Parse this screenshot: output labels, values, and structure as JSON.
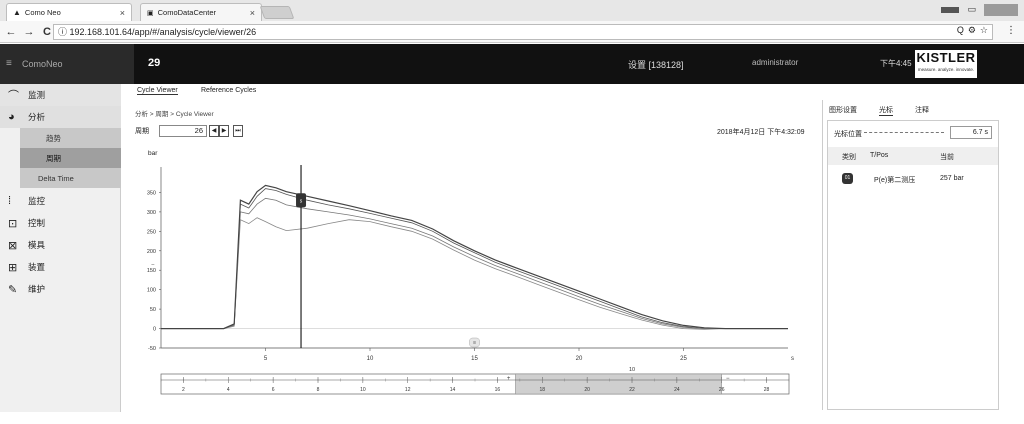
{
  "browser": {
    "tabs": [
      {
        "label": "Como Neo",
        "close": "×"
      },
      {
        "label": "ComoDataCenter",
        "close": "×"
      }
    ],
    "nav": {
      "back": "←",
      "forward": "→",
      "reload": "C"
    },
    "url": "ⓘ 192.168.101.64/app/#/analysis/cycle/viewer/26",
    "url_icons": [
      "Q",
      "⚙",
      "☆"
    ],
    "menu": "⋮"
  },
  "header": {
    "brand": "ComoNeo",
    "cycle_number": "29",
    "setting": "设置 [138128]",
    "user": "administrator",
    "time": "下午4:45",
    "logo_text": "KISTLER",
    "logo_tagline": "measure. analyze. innovate."
  },
  "sidebar": {
    "items": [
      {
        "icon": "⌒",
        "label": "监测",
        "icon_name": "wave-icon"
      },
      {
        "icon": "◕",
        "label": "分析",
        "icon_name": "analysis-icon"
      },
      {
        "icon": "⁞",
        "label": "监控",
        "icon_name": "monitor-icon"
      },
      {
        "icon": "⊡",
        "label": "控制",
        "icon_name": "control-icon"
      },
      {
        "icon": "⊠",
        "label": "模具",
        "icon_name": "mold-icon"
      },
      {
        "icon": "⊞",
        "label": "装置",
        "icon_name": "device-icon"
      },
      {
        "icon": "✎",
        "label": "维护",
        "icon_name": "maintenance-icon"
      }
    ],
    "subitems": [
      {
        "label": "趋势",
        "selected": false
      },
      {
        "label": "周期",
        "selected": true
      },
      {
        "label": "Delta Time",
        "selected": false
      }
    ]
  },
  "subtabs": [
    "Cycle Viewer",
    "Reference Cycles"
  ],
  "main": {
    "breadcrumb": "分析 > 周期 > Cycle Viewer",
    "cycle_label": "周期",
    "cycle_value": "26",
    "prev": "◀",
    "next": "▶",
    "last": "⏭",
    "datetime": "2018年4月12日 下午4:32:09",
    "unit": "bar",
    "cursor_marker": "s",
    "scrollbar_knob": "≡",
    "tick_labels": [
      "5",
      "10",
      "15",
      "20",
      "25"
    ],
    "x_unit": "s"
  },
  "chart_data": {
    "type": "line",
    "xlabel": "s",
    "ylabel": "bar",
    "xlim": [
      0,
      30
    ],
    "ylim": [
      -50,
      400
    ],
    "yticks": [
      350,
      300,
      250,
      200,
      150,
      100,
      50,
      0,
      -50
    ],
    "xticks": [
      5,
      10,
      15,
      20,
      25
    ],
    "cursor_x": 6.7,
    "series": [
      {
        "x": [
          0,
          3.0,
          3.5,
          3.8,
          4.2,
          4.6,
          5.0,
          5.5,
          6.0,
          7.0,
          8.0,
          9.0,
          10.0,
          11.0,
          12.0,
          13.0,
          14.0,
          15.0,
          16.0,
          17.0,
          18.0,
          19.0,
          20.0,
          21.0,
          22.0,
          23.0,
          24.0,
          25.0,
          26.0,
          27.0,
          30.0
        ],
        "y": [
          0,
          0,
          10,
          320,
          310,
          340,
          360,
          355,
          345,
          330,
          318,
          308,
          296,
          284,
          272,
          250,
          220,
          195,
          170,
          150,
          130,
          110,
          90,
          70,
          50,
          30,
          15,
          5,
          0,
          0,
          0
        ]
      },
      {
        "x": [
          0,
          3.0,
          3.5,
          3.8,
          4.2,
          4.6,
          5.0,
          5.5,
          6.0,
          7.0,
          8.0,
          9.0,
          10.0,
          11.0,
          12.0,
          13.0,
          14.0,
          15.0,
          16.0,
          17.0,
          18.0,
          19.0,
          20.0,
          21.0,
          22.0,
          23.0,
          24.0,
          25.0,
          26.0,
          27.0,
          30.0
        ],
        "y": [
          0,
          0,
          8,
          300,
          295,
          320,
          335,
          330,
          318,
          308,
          300,
          292,
          282,
          270,
          258,
          238,
          210,
          185,
          162,
          142,
          122,
          102,
          82,
          62,
          44,
          26,
          12,
          3,
          0,
          0,
          0
        ]
      },
      {
        "x": [
          0,
          3.0,
          3.5,
          3.8,
          4.2,
          4.6,
          5.0,
          5.5,
          6.0,
          7.0,
          8.0,
          9.0,
          10.0,
          11.0,
          12.0,
          13.0,
          14.0,
          15.0,
          16.0,
          17.0,
          18.0,
          19.0,
          20.0,
          21.0,
          22.0,
          23.0,
          24.0,
          25.0,
          26.0,
          27.0,
          30.0
        ],
        "y": [
          0,
          0,
          6,
          280,
          270,
          285,
          275,
          262,
          252,
          258,
          270,
          280,
          275,
          262,
          250,
          230,
          202,
          176,
          154,
          134,
          114,
          94,
          74,
          55,
          38,
          22,
          9,
          0,
          -2,
          0,
          0
        ]
      },
      {
        "x": [
          0,
          3.0,
          3.5,
          3.8,
          4.2,
          4.6,
          5.0,
          5.5,
          6.0,
          7.0,
          8.0,
          9.0,
          10.0,
          11.0,
          12.0,
          13.0,
          14.0,
          15.0,
          16.0,
          17.0,
          18.0,
          19.0,
          20.0,
          21.0,
          22.0,
          23.0,
          24.0,
          25.0,
          26.0,
          27.0,
          30.0
        ],
        "y": [
          0,
          0,
          12,
          330,
          320,
          352,
          368,
          362,
          352,
          340,
          328,
          316,
          303,
          290,
          278,
          256,
          226,
          200,
          176,
          156,
          136,
          116,
          96,
          76,
          56,
          36,
          20,
          8,
          2,
          0,
          0
        ]
      }
    ]
  },
  "range_axis": {
    "ticks": [
      "2",
      "4",
      "6",
      "8",
      "10",
      "12",
      "14",
      "16",
      "18",
      "20",
      "22",
      "24",
      "26",
      "28"
    ],
    "center_label": "10",
    "handle_plus": "+",
    "handle_minus": "−",
    "selection_start": 18,
    "selection_end": 26
  },
  "right_panel": {
    "tabs": [
      "图形设置",
      "光标",
      "注释"
    ],
    "cursor_label": "光标位置",
    "cursor_value": "6.7 s",
    "col_type": "类别",
    "col_tpos": "T/Pos",
    "col_current": "当前",
    "rows": [
      {
        "icon": "01",
        "name": "P(e)第二测压",
        "value": "257 bar"
      }
    ]
  }
}
